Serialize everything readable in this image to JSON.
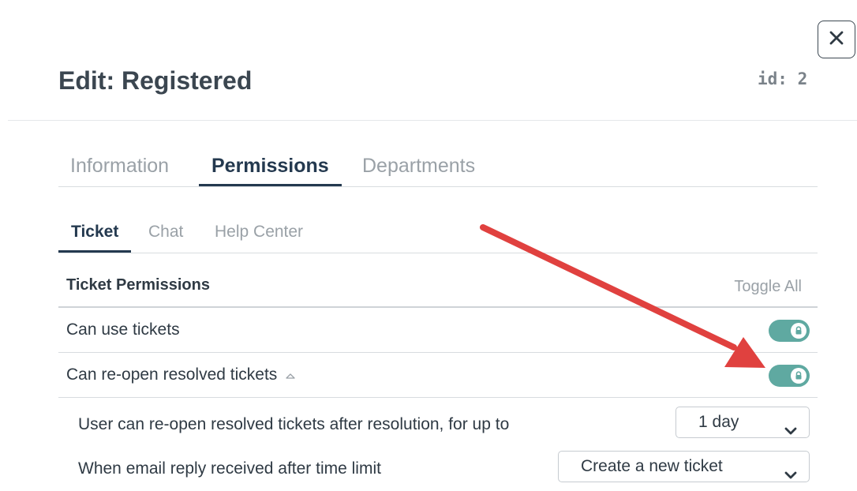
{
  "dialog": {
    "title": "Edit: Registered",
    "id_label": "id: 2"
  },
  "main_tabs": [
    {
      "label": "Information",
      "active": false
    },
    {
      "label": "Permissions",
      "active": true
    },
    {
      "label": "Departments",
      "active": false
    }
  ],
  "sub_tabs": [
    {
      "label": "Ticket",
      "active": true
    },
    {
      "label": "Chat",
      "active": false
    },
    {
      "label": "Help Center",
      "active": false
    }
  ],
  "permissions": {
    "section_title": "Ticket Permissions",
    "toggle_all_label": "Toggle All",
    "rows": [
      {
        "label": "Can use tickets",
        "enabled": true,
        "locked": true
      },
      {
        "label": "Can re-open resolved tickets",
        "enabled": true,
        "locked": true
      }
    ],
    "options": [
      {
        "label": "User can re-open resolved tickets after resolution, for up to",
        "value": "1 day"
      },
      {
        "label": "When email reply received after time limit",
        "value": "Create a new ticket"
      }
    ]
  },
  "colors": {
    "toggle_on": "#5fa9a1",
    "annotation_arrow": "#e0413f",
    "active_tab": "#24394f"
  }
}
